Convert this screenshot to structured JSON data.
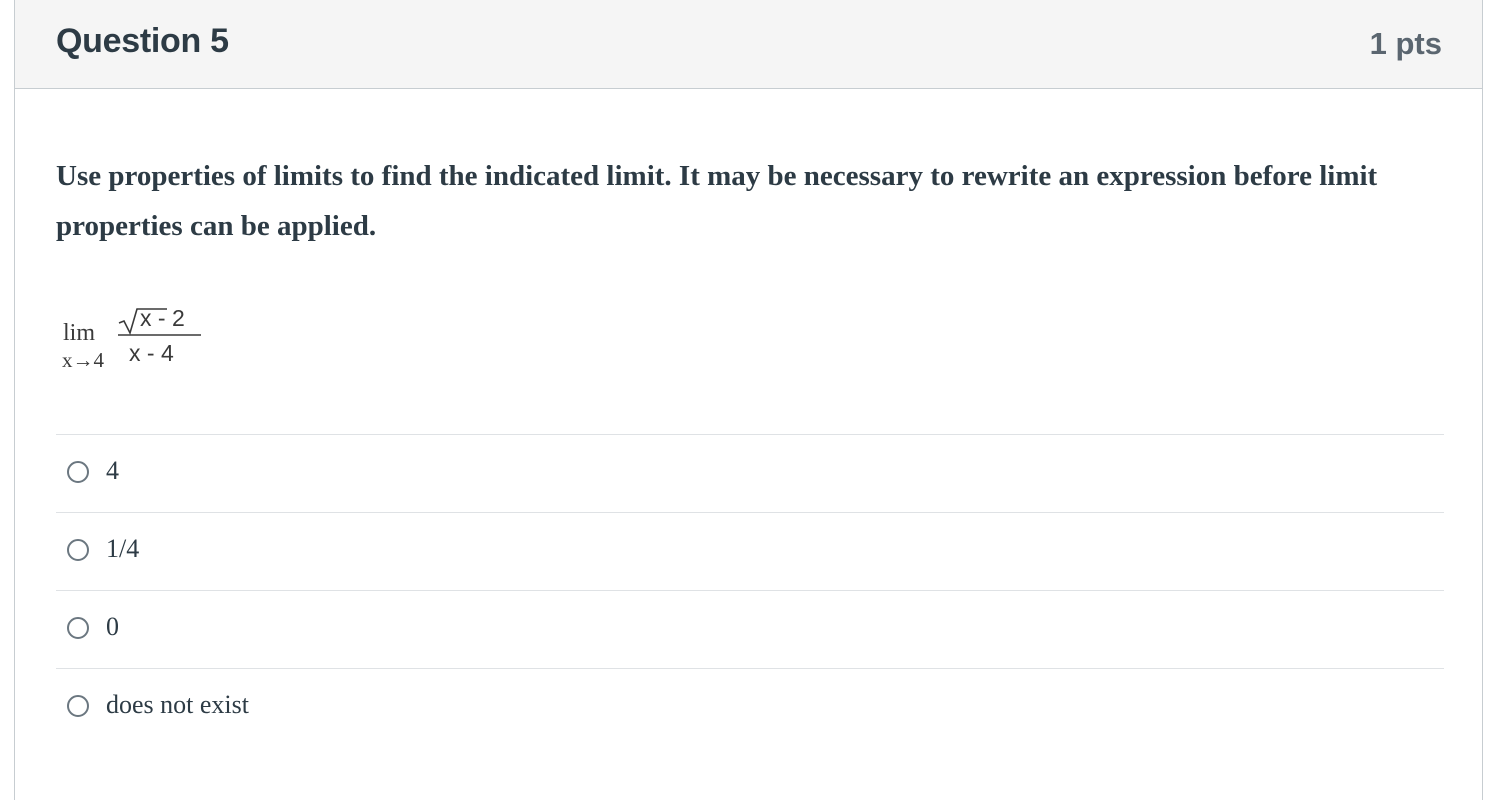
{
  "question": {
    "title": "Question 5",
    "points": "1 pts",
    "prompt": "Use properties of limits to find the indicated limit. It may be necessary to rewrite an expression before limit properties can be applied.",
    "math": {
      "lim": "lim",
      "approach": "x→4",
      "numerator": "x - 2",
      "denominator": "x - 4"
    },
    "options": [
      {
        "label": "4"
      },
      {
        "label": "1/4"
      },
      {
        "label": "0"
      },
      {
        "label": "does not exist"
      }
    ]
  }
}
